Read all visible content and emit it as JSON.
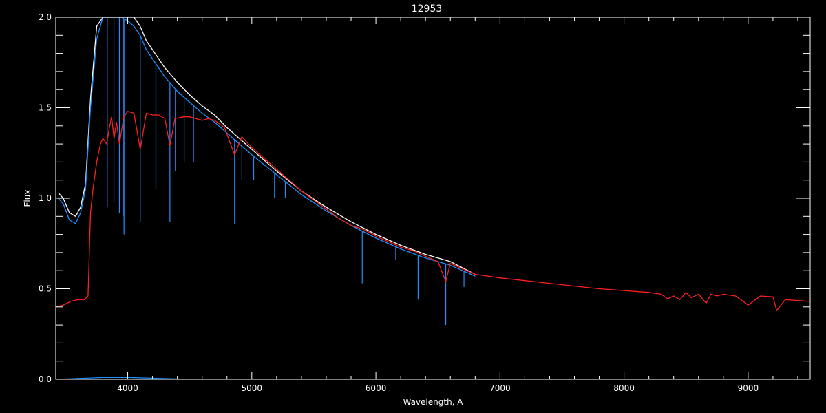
{
  "chart_data": {
    "type": "line",
    "title": "12953",
    "xlabel": "Wavelength, A",
    "ylabel": "Flux",
    "xlim": [
      3420,
      9500
    ],
    "ylim": [
      0.0,
      2.0
    ],
    "x_ticks": [
      4000,
      5000,
      6000,
      7000,
      8000,
      9000
    ],
    "x_tick_labels": [
      "4000",
      "5000",
      "6000",
      "7000",
      "8000",
      "9000"
    ],
    "y_ticks": [
      0.0,
      0.5,
      1.0,
      1.5,
      2.0
    ],
    "y_tick_labels": [
      "0.0",
      "0.5",
      "1.0",
      "1.5",
      "2.0"
    ],
    "grid": false,
    "background": "#000000",
    "series": [
      {
        "color": "#ffffff",
        "x": [
          3440,
          3480,
          3530,
          3580,
          3620,
          3660,
          3700,
          3750,
          3800,
          3850,
          3900,
          3950,
          4000,
          4050,
          4100,
          4150,
          4200,
          4300,
          4400,
          4500,
          4600,
          4700,
          4800,
          4900,
          5000,
          5200,
          5400,
          5600,
          5800,
          6000,
          6200,
          6400,
          6600,
          6800
        ],
        "y": [
          1.03,
          1.0,
          0.92,
          0.9,
          0.95,
          1.08,
          1.55,
          1.95,
          2.05,
          2.06,
          2.06,
          2.05,
          2.03,
          2.0,
          1.95,
          1.87,
          1.82,
          1.72,
          1.64,
          1.57,
          1.51,
          1.46,
          1.39,
          1.33,
          1.27,
          1.15,
          1.04,
          0.95,
          0.87,
          0.8,
          0.74,
          0.69,
          0.65,
          0.58
        ]
      },
      {
        "color": "#1e90ff",
        "x": [
          3440,
          3480,
          3530,
          3580,
          3620,
          3660,
          3700,
          3750,
          3800,
          3850,
          3900,
          3950,
          4000,
          4050,
          4100,
          4150,
          4200,
          4300,
          4400,
          4500,
          4600,
          4700,
          4800,
          4900,
          5000,
          5200,
          5400,
          5600,
          5800,
          6000,
          6200,
          6400,
          6600,
          6800
        ],
        "y": [
          1.0,
          0.97,
          0.88,
          0.86,
          0.92,
          1.05,
          1.5,
          1.88,
          2.0,
          2.01,
          2.01,
          2.0,
          1.98,
          1.95,
          1.9,
          1.82,
          1.77,
          1.67,
          1.59,
          1.53,
          1.47,
          1.42,
          1.36,
          1.3,
          1.24,
          1.13,
          1.02,
          0.93,
          0.85,
          0.78,
          0.72,
          0.67,
          0.63,
          0.57
        ],
        "absorption_lines": [
          {
            "x": 3835,
            "y": 0.95
          },
          {
            "x": 3889,
            "y": 0.98
          },
          {
            "x": 3933,
            "y": 0.92
          },
          {
            "x": 3968,
            "y": 0.9
          },
          {
            "x": 3970,
            "y": 0.8
          },
          {
            "x": 4101,
            "y": 0.87
          },
          {
            "x": 4227,
            "y": 1.05
          },
          {
            "x": 4340,
            "y": 0.87
          },
          {
            "x": 4384,
            "y": 1.15
          },
          {
            "x": 4455,
            "y": 1.2
          },
          {
            "x": 4530,
            "y": 1.2
          },
          {
            "x": 4861,
            "y": 0.86
          },
          {
            "x": 4920,
            "y": 1.1
          },
          {
            "x": 5015,
            "y": 1.1
          },
          {
            "x": 5183,
            "y": 1.0
          },
          {
            "x": 5270,
            "y": 1.0
          },
          {
            "x": 5890,
            "y": 0.53
          },
          {
            "x": 6160,
            "y": 0.66
          },
          {
            "x": 6340,
            "y": 0.44
          },
          {
            "x": 6563,
            "y": 0.3
          },
          {
            "x": 6710,
            "y": 0.51
          }
        ],
        "baseline": {
          "x": [
            3440,
            3800,
            4000,
            4500,
            5000,
            5500,
            6000,
            6500,
            6800
          ],
          "y": [
            0.0,
            0.01,
            0.01,
            0.0,
            0.0,
            0.0,
            0.0,
            0.0,
            0.0
          ]
        }
      },
      {
        "color": "#ff2020",
        "x": [
          3420,
          3480,
          3540,
          3600,
          3650,
          3680,
          3700,
          3720,
          3750,
          3780,
          3800,
          3830,
          3850,
          3870,
          3890,
          3910,
          3933,
          3968,
          4000,
          4050,
          4101,
          4150,
          4200,
          4250,
          4300,
          4340,
          4380,
          4450,
          4500,
          4550,
          4600,
          4650,
          4700,
          4780,
          4861,
          4920,
          5000,
          5100,
          5200,
          5300,
          5400,
          5500,
          5600,
          5700,
          5800,
          5890,
          5950,
          6000,
          6100,
          6200,
          6300,
          6400,
          6500,
          6563,
          6600,
          6700,
          6800,
          7000,
          7200,
          7400,
          7600,
          7800,
          8000,
          8200,
          8300,
          8350,
          8400,
          8450,
          8500,
          8542,
          8600,
          8662,
          8700,
          8750,
          8800,
          8900,
          9000,
          9100,
          9200,
          9230,
          9300,
          9400,
          9500
        ],
        "y": [
          0.4,
          0.41,
          0.43,
          0.44,
          0.44,
          0.46,
          0.92,
          1.05,
          1.2,
          1.3,
          1.33,
          1.3,
          1.38,
          1.45,
          1.33,
          1.42,
          1.3,
          1.45,
          1.48,
          1.47,
          1.27,
          1.47,
          1.46,
          1.46,
          1.44,
          1.29,
          1.44,
          1.45,
          1.45,
          1.44,
          1.43,
          1.44,
          1.43,
          1.39,
          1.24,
          1.34,
          1.28,
          1.22,
          1.16,
          1.1,
          1.04,
          0.99,
          0.94,
          0.89,
          0.85,
          0.83,
          0.81,
          0.79,
          0.76,
          0.73,
          0.71,
          0.68,
          0.65,
          0.54,
          0.64,
          0.61,
          0.58,
          0.56,
          0.545,
          0.53,
          0.515,
          0.5,
          0.49,
          0.48,
          0.47,
          0.445,
          0.46,
          0.44,
          0.48,
          0.45,
          0.47,
          0.42,
          0.47,
          0.46,
          0.47,
          0.46,
          0.41,
          0.46,
          0.455,
          0.38,
          0.44,
          0.435,
          0.43
        ]
      }
    ]
  }
}
